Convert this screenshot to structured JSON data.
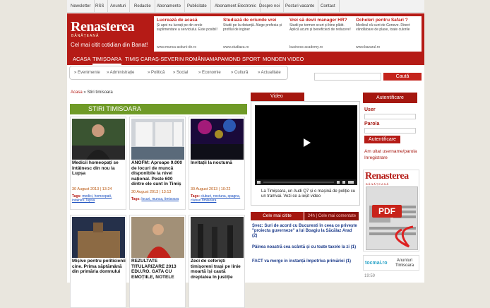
{
  "topbar": [
    "Newsletter",
    "RSS",
    "Anunturi",
    "Redactie",
    "Abonamente",
    "Publicitate",
    "Abonament Electronic",
    "Despre noi",
    "Posturi vacante",
    "Contact"
  ],
  "header": {
    "logo": "Renasterea",
    "logo_sub": "BĂNĂȚEANĂ",
    "tagline": "Cel mai citit cotidian din Banat!"
  },
  "ads": [
    {
      "title": "Lucrează de acasă",
      "body": "Și apoi nu lucrați pe din orele suplimentare a serviciului. Este posibil!",
      "url": "www.munca-actiuni-de.ro"
    },
    {
      "title": "Studiază de oriunde vrei",
      "body": "Studii pe la distanță. Alege profesia și profilul de inginer",
      "url": "www.studiaza.ro"
    },
    {
      "title": "Vrei să devii manager HR?",
      "body": "Studii pe termen scurt și bine plătit. Aplică acum și beneficiezi de reducere!",
      "url": "business-academy.ro"
    },
    {
      "title": "Ocheleri pentru Safari ?",
      "body": "Medicul că sunt de Geneve. Direct vândătoare de plase, toate culorile",
      "url": "www.bazarul.ro"
    }
  ],
  "nav": [
    "ACASA",
    "TIMIȘOARA",
    "TIMIȘ",
    "CARAȘ-SEVERIN",
    "ROMÂNIA",
    "MAPAMOND",
    "SPORT",
    "MONDEN",
    "VIDEO"
  ],
  "subnav": [
    "» Evenimente",
    "» Administrație",
    "» Politică",
    "» Social",
    "» Economie",
    "» Cultură",
    "» Actualitate"
  ],
  "search": {
    "button": "Caută",
    "value": ""
  },
  "breadcrumb": {
    "home": "Acasa",
    "sep": " » ",
    "current": "Stiri timisoara"
  },
  "section_title": "STIRI TIMISOARA",
  "articles": [
    {
      "title": "Medicii homeopați se întâlnesc din nou la Lupșa",
      "date": "30 August 2013 | 13:24",
      "tag_label": "Tags:",
      "tags": "medici, homeopati, intalnire, lupsa"
    },
    {
      "title": "ANOFM: Aproape 9.000 de locuri de muncă disponibile la nivel național. Peste 600 dintre ele sunt în Timiș",
      "date": "30 August 2013 | 13:13",
      "tag_label": "Tags:",
      "tags": "locuri, munca, timisoara"
    },
    {
      "title": "Invitații la noctumă",
      "date": "30 August 2013 | 10:22",
      "tag_label": "Tags:",
      "tags": "cluburi, noctuna, spagna, cluburi timisoara"
    },
    {
      "title": "Mișive pentru politicienii cine. Prima săptămână din primăria domnului",
      "date": "",
      "tag_label": "",
      "tags": ""
    },
    {
      "title": "REZULTATE TITULARIZARE 2013 EDU.RO. GATA CU EMOȚIILE, NOTELE",
      "date": "",
      "tag_label": "",
      "tags": ""
    },
    {
      "title": "Zeci de ceferiști timișoreni trași pe linie moartă își caută dreptatea în justiție",
      "date": "",
      "tag_label": "",
      "tags": ""
    }
  ],
  "video": {
    "tab": "Video",
    "caption": "La Timișoara, un Audi Q7 și o mașină de poliție cu un tramvai. Vezi ce a ieșit video"
  },
  "most_read": {
    "tab1": "Cele mai citite",
    "tab2": "24h | Cele mai comentate",
    "items": [
      "Șvez: Suri de acord cu Bucuresti în ceea ce privește \"proiecta guverneze\" a lui Boagiu la Săcălaz Arad (2)",
      "Pâinea noastră cea scântă și cu toate taxele la zi (1)",
      "FACT va merge in instanță împotriva primăriei (1)"
    ]
  },
  "auth": {
    "title": "Autentificare",
    "user_label": "User",
    "pass_label": "Parola",
    "button": "Autentificare",
    "forgot": "Am uitat username/parola",
    "register": "Inregistrare"
  },
  "pdf": {
    "logo": "Renasterea",
    "logo_sub": "BĂNĂȚEANĂ",
    "label": "PDF"
  },
  "tocmai": {
    "logo": "tocmai.ro",
    "text": "Anunturi Timisoara"
  },
  "time": "19:59"
}
